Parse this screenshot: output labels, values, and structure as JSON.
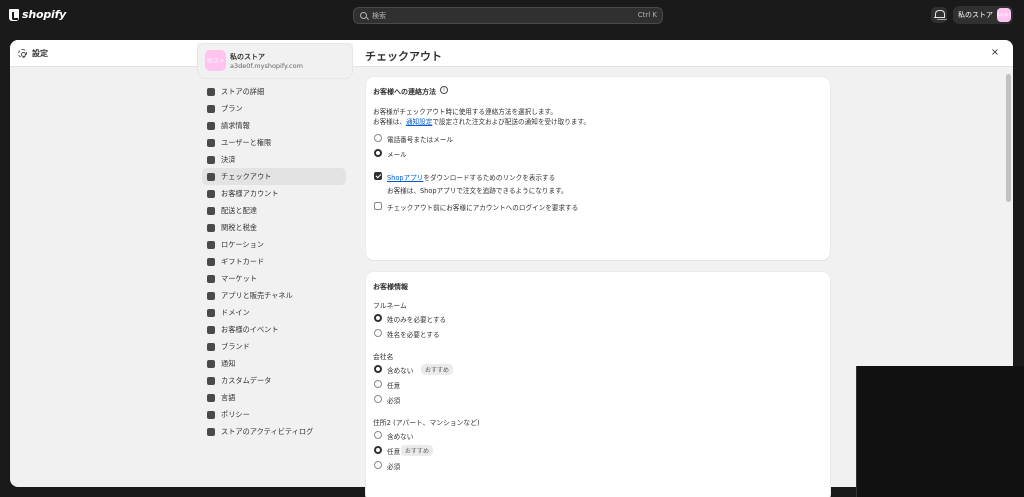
{
  "topbar": {
    "logo_text": "shopify",
    "search_placeholder": "検索",
    "search_shortcut": "Ctrl K",
    "store_name": "私のストア",
    "store_avatar": "私のスト"
  },
  "modal": {
    "title": "設定",
    "close_label": "×"
  },
  "sidebar": {
    "store": {
      "avatar": "のスト",
      "name": "私のストア",
      "domain": "a3de0f.myshopify.com"
    },
    "items": [
      {
        "label": "ストアの詳細",
        "icon": "store-icon"
      },
      {
        "label": "プラン",
        "icon": "plan-icon"
      },
      {
        "label": "請求情報",
        "icon": "billing-icon"
      },
      {
        "label": "ユーザーと権限",
        "icon": "users-icon"
      },
      {
        "label": "決済",
        "icon": "payments-icon"
      },
      {
        "label": "チェックアウト",
        "icon": "cart-icon",
        "active": true
      },
      {
        "label": "お客様アカウント",
        "icon": "person-icon"
      },
      {
        "label": "配送と配達",
        "icon": "truck-icon"
      },
      {
        "label": "関税と税金",
        "icon": "tax-icon"
      },
      {
        "label": "ロケーション",
        "icon": "location-icon"
      },
      {
        "label": "ギフトカード",
        "icon": "gift-card-icon"
      },
      {
        "label": "マーケット",
        "icon": "globe-icon"
      },
      {
        "label": "アプリと販売チャネル",
        "icon": "apps-icon"
      },
      {
        "label": "ドメイン",
        "icon": "domain-icon"
      },
      {
        "label": "お客様のイベント",
        "icon": "events-icon"
      },
      {
        "label": "ブランド",
        "icon": "brand-icon"
      },
      {
        "label": "通知",
        "icon": "bell-icon"
      },
      {
        "label": "カスタムデータ",
        "icon": "data-icon"
      },
      {
        "label": "言語",
        "icon": "language-icon"
      },
      {
        "label": "ポリシー",
        "icon": "policy-icon"
      },
      {
        "label": "ストアのアクティビティログ",
        "icon": "list-icon"
      }
    ]
  },
  "main": {
    "page_title": "チェックアウト",
    "contact": {
      "title": "お客様への連絡方法",
      "info_icon": "i",
      "desc1": "お客様がチェックアウト時に使用する連絡方法を選択します。",
      "desc2_pre": "お客様は、",
      "desc2_link": "通知設定",
      "desc2_post": "で設定された注文および配送の通知を受け取ります。",
      "options": [
        {
          "label": "電話番号またはメール",
          "selected": false
        },
        {
          "label": "メール",
          "selected": true
        }
      ],
      "shop_link": "Shopアプリ",
      "shop_label_post": "をダウンロードするためのリンクを表示する",
      "shop_help": "お客様は、Shopアプリで注文を追跡できるようになります。",
      "shop_checked": true,
      "login_label": "チェックアウト前にお客様にアカウントへのログインを要求する",
      "login_checked": false
    },
    "customer_info": {
      "title": "お客様情報",
      "fullname_label": "フルネーム",
      "fullname_options": [
        {
          "label": "姓のみを必要とする",
          "selected": true
        },
        {
          "label": "姓名を必要とする",
          "selected": false
        }
      ],
      "company_label": "会社名",
      "company_options": [
        {
          "label": "含めない",
          "selected": true,
          "badge": "おすすめ"
        },
        {
          "label": "任意",
          "selected": false
        },
        {
          "label": "必須",
          "selected": false
        }
      ],
      "address2_label": "住所2 (アパート、マンションなど)",
      "address2_options": [
        {
          "label": "含めない",
          "selected": false
        },
        {
          "label": "任意",
          "selected": true,
          "badge": "おすすめ"
        },
        {
          "label": "必須",
          "selected": false
        }
      ]
    }
  }
}
